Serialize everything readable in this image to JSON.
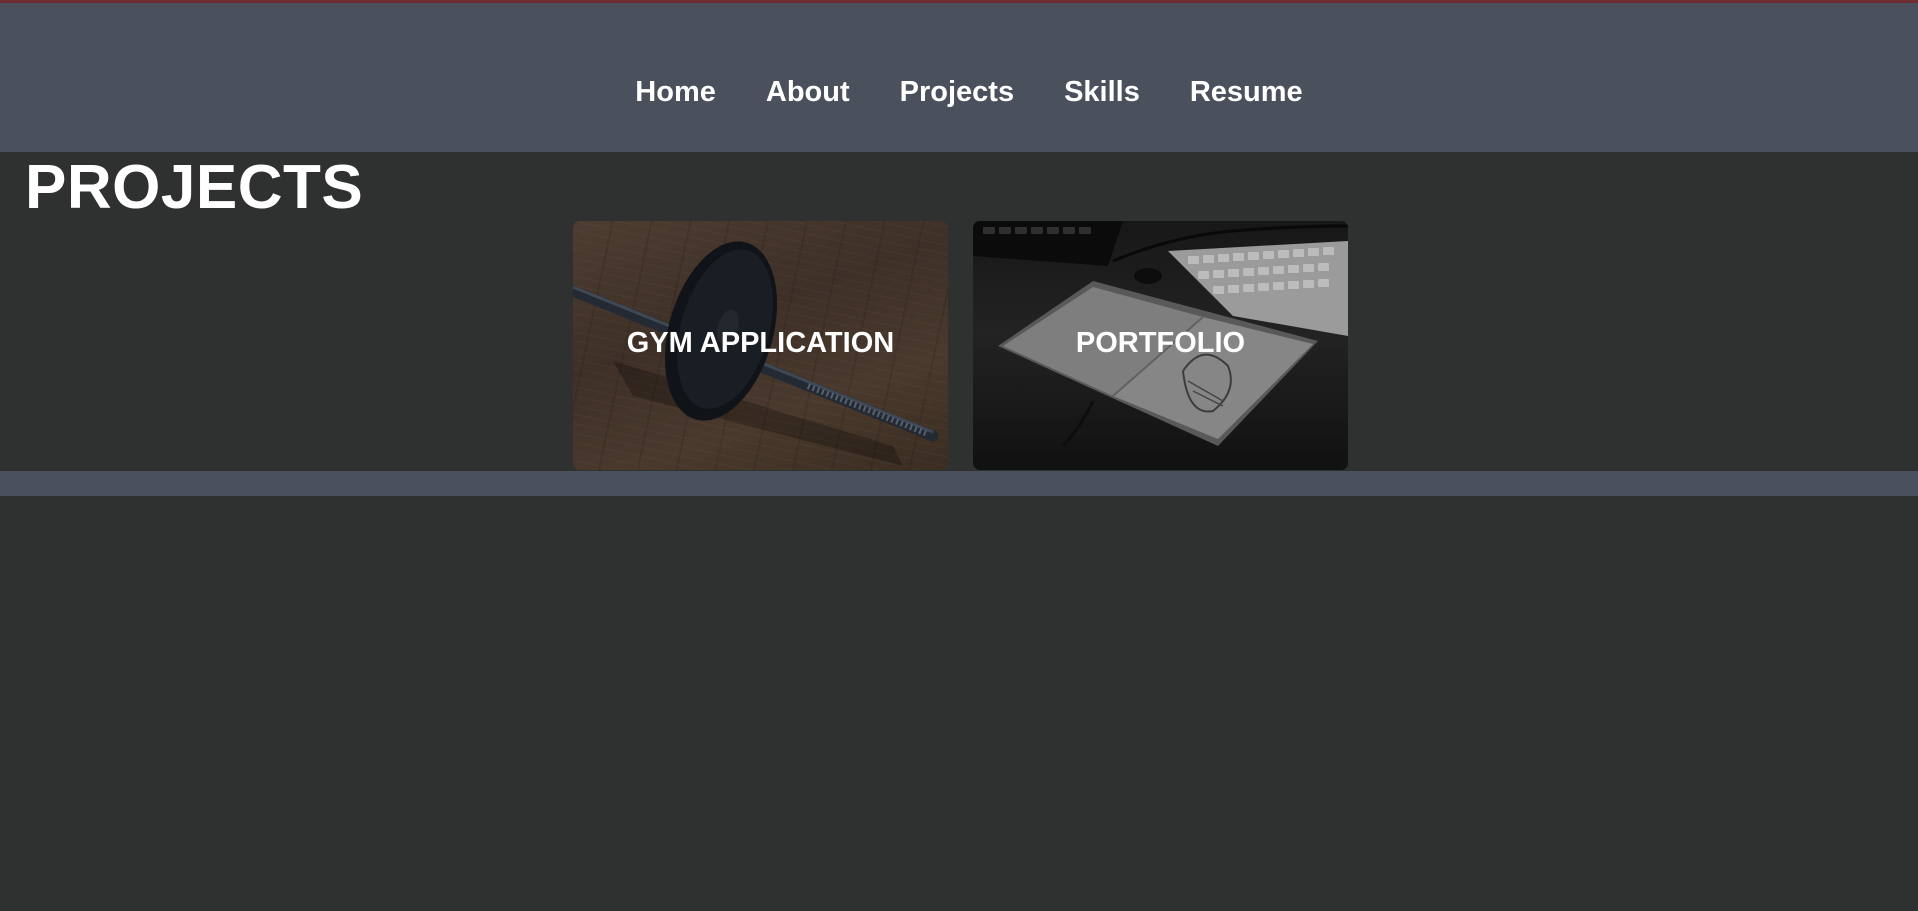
{
  "nav": {
    "items": [
      {
        "label": "Home"
      },
      {
        "label": "About"
      },
      {
        "label": "Projects"
      },
      {
        "label": "Skills"
      },
      {
        "label": "Resume"
      }
    ]
  },
  "page": {
    "title": "PROJECTS"
  },
  "projects": [
    {
      "label": "GYM APPLICATION",
      "image": "barbell-image"
    },
    {
      "label": "PORTFOLIO",
      "image": "desk-notebook-image"
    }
  ],
  "colors": {
    "background": "#2f3030",
    "navbar": "#4a515c",
    "accent": "#6e2d33",
    "text": "#ffffff"
  }
}
